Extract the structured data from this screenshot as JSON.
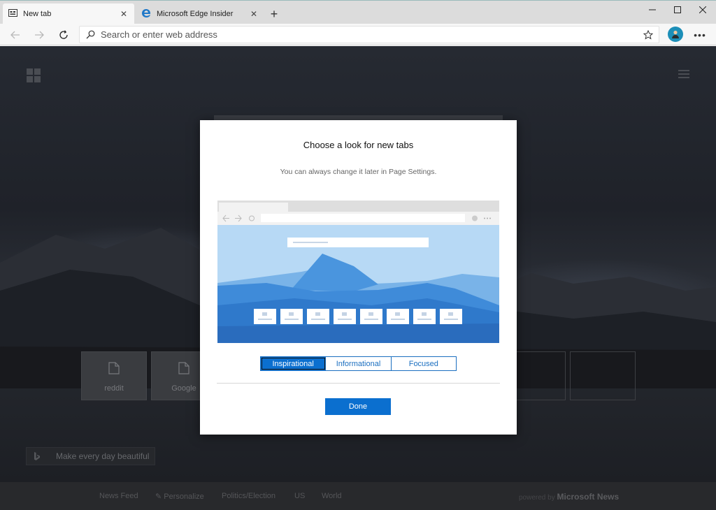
{
  "browser": {
    "tabs": [
      {
        "title": "New tab",
        "icon": "newtab-page-icon",
        "active": true
      },
      {
        "title": "Microsoft Edge Insider",
        "icon": "edge-logo-icon",
        "active": false
      }
    ],
    "new_tab_icon": "plus-icon",
    "window_controls": [
      "minimize-icon",
      "maximize-icon",
      "close-icon"
    ],
    "address_bar": {
      "value": "",
      "placeholder": "Search or enter web address"
    }
  },
  "new_tab_page": {
    "tiles": [
      {
        "label": "reddit"
      },
      {
        "label": "Google"
      }
    ],
    "daily_image_caption": "Make every day beautiful",
    "news_links": [
      "News Feed",
      "Personalize",
      "Politics/Election",
      "US",
      "World"
    ],
    "powered_by_prefix": "powered by",
    "powered_by_brand": "Microsoft News"
  },
  "modal": {
    "title": "Choose a look for new tabs",
    "subtitle": "You can always change it later in Page Settings.",
    "options": [
      "Inspirational",
      "Informational",
      "Focused"
    ],
    "selected_option": "Inspirational",
    "done_label": "Done"
  },
  "colors": {
    "accent": "#0b6fcf",
    "preview_sky": "#b7d9f5",
    "ntp_background": "#23262c"
  }
}
